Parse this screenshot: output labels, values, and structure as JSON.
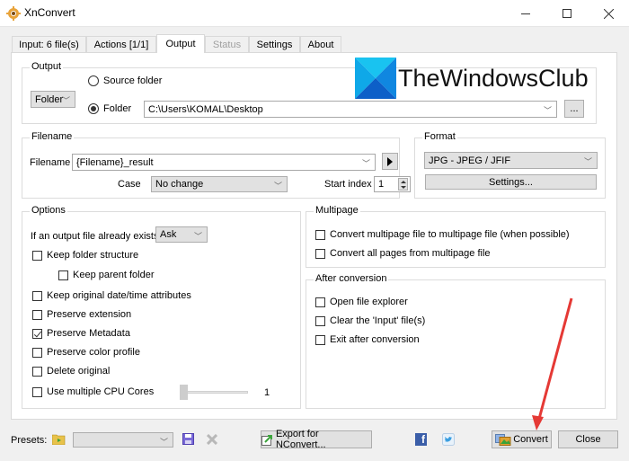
{
  "window": {
    "title": "XnConvert",
    "minimize_label": "—",
    "maximize_label": "☐",
    "close_label": "✕"
  },
  "tabs": [
    {
      "label": "Input: 6 file(s)",
      "state": "normal"
    },
    {
      "label": "Actions [1/1]",
      "state": "normal"
    },
    {
      "label": "Output",
      "state": "active"
    },
    {
      "label": "Status",
      "state": "disabled"
    },
    {
      "label": "Settings",
      "state": "normal"
    },
    {
      "label": "About",
      "state": "normal"
    }
  ],
  "watermark": {
    "text": "TheWindowsClub"
  },
  "output_group": {
    "title": "Output",
    "type_select": "Folder",
    "radio_source_label": "Source folder",
    "radio_folder_label": "Folder",
    "selected": "Folder",
    "folder_path": "C:\\Users\\KOMAL\\Desktop",
    "browse_label": "..."
  },
  "filename_group": {
    "title": "Filename",
    "filename_label": "Filename",
    "filename_value": "{Filename}_result",
    "case_label": "Case",
    "case_value": "No change",
    "start_index_label": "Start index",
    "start_index_value": "1"
  },
  "format_group": {
    "title": "Format",
    "format_value": "JPG - JPEG / JFIF",
    "settings_label": "Settings..."
  },
  "options_group": {
    "title": "Options",
    "exists_label": "If an output file already exists",
    "exists_value": "Ask",
    "checkboxes": [
      {
        "label": "Keep folder structure",
        "checked": false
      },
      {
        "label": "Keep parent folder",
        "checked": false
      },
      {
        "label": "Keep original date/time attributes",
        "checked": false
      },
      {
        "label": "Preserve extension",
        "checked": false
      },
      {
        "label": "Preserve Metadata",
        "checked": true
      },
      {
        "label": "Preserve color profile",
        "checked": false
      },
      {
        "label": "Delete original",
        "checked": false
      },
      {
        "label": "Use multiple CPU Cores",
        "checked": false
      }
    ],
    "cpu_cores_value": "1"
  },
  "multipage_group": {
    "title": "Multipage",
    "checkboxes": [
      {
        "label": "Convert multipage file to multipage file (when possible)",
        "checked": false
      },
      {
        "label": "Convert all pages from multipage file",
        "checked": false
      }
    ]
  },
  "after_group": {
    "title": "After conversion",
    "checkboxes": [
      {
        "label": "Open file explorer",
        "checked": false
      },
      {
        "label": "Clear the 'Input' file(s)",
        "checked": false
      },
      {
        "label": "Exit after conversion",
        "checked": false
      }
    ]
  },
  "footer": {
    "presets_label": "Presets:",
    "presets_value": "",
    "export_label": "Export for NConvert...",
    "facebook_label": "f",
    "convert_label": "Convert",
    "close_label": "Close"
  },
  "annotation": {
    "arrow_color": "#e53935"
  }
}
